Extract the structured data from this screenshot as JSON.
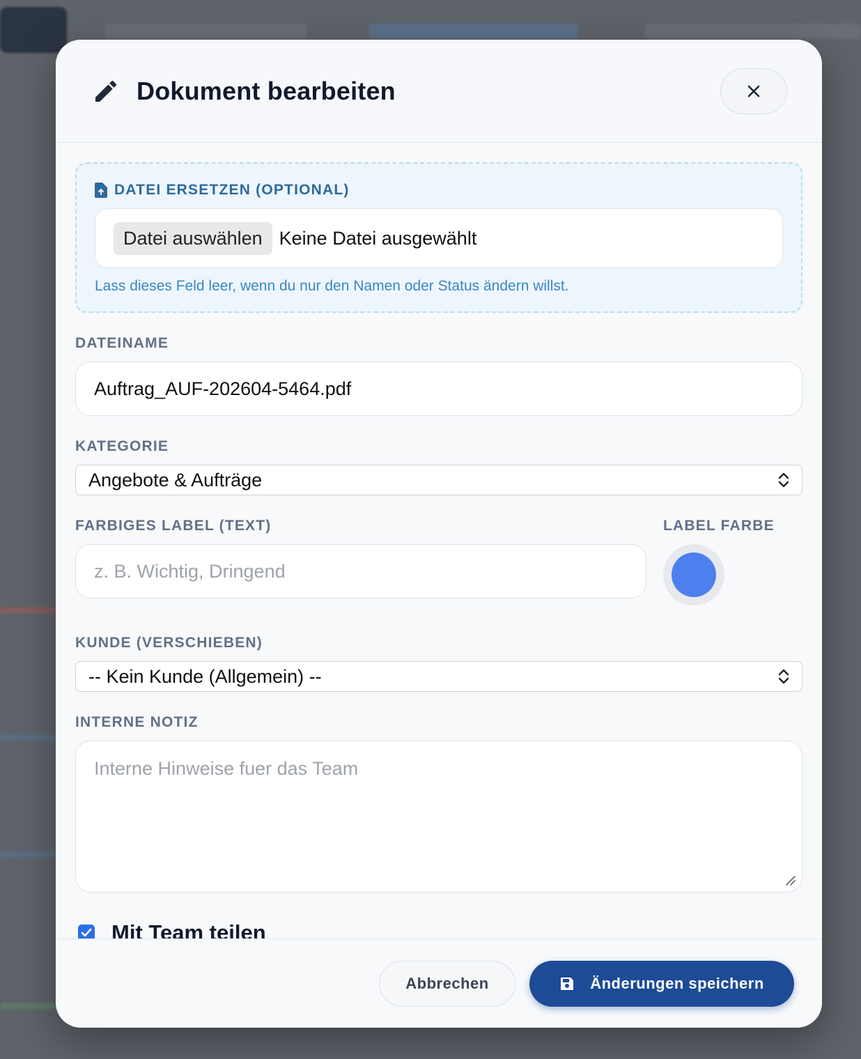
{
  "modal": {
    "title": "Dokument bearbeiten",
    "close_icon": "close-icon"
  },
  "replace_file": {
    "label": "DATEI ERSETZEN (OPTIONAL)",
    "button_label": "Datei auswählen",
    "status": "Keine Datei ausgewählt",
    "hint": "Lass dieses Feld leer, wenn du nur den Namen oder Status ändern willst."
  },
  "filename": {
    "label": "DATEINAME",
    "value": "Auftrag_AUF-202604-5464.pdf"
  },
  "category": {
    "label": "KATEGORIE",
    "selected": "Angebote & Aufträge"
  },
  "colored_label": {
    "label": "FARBIGES LABEL (TEXT)",
    "placeholder": "z. B. Wichtig, Dringend",
    "value": ""
  },
  "label_color": {
    "label": "LABEL FARBE",
    "color": "#4d7fee"
  },
  "customer": {
    "label": "KUNDE (VERSCHIEBEN)",
    "selected": "-- Kein Kunde (Allgemein) --"
  },
  "note": {
    "label": "INTERNE NOTIZ",
    "placeholder": "Interne Hinweise fuer das Team",
    "value": ""
  },
  "share": {
    "label": "Mit Team teilen",
    "checked": true
  },
  "footer": {
    "cancel_label": "Abbrechen",
    "save_label": "Änderungen speichern"
  },
  "colors": {
    "accent": "#1e4b96",
    "checkbox": "#2b6fe8",
    "hint": "#3a86c4"
  }
}
